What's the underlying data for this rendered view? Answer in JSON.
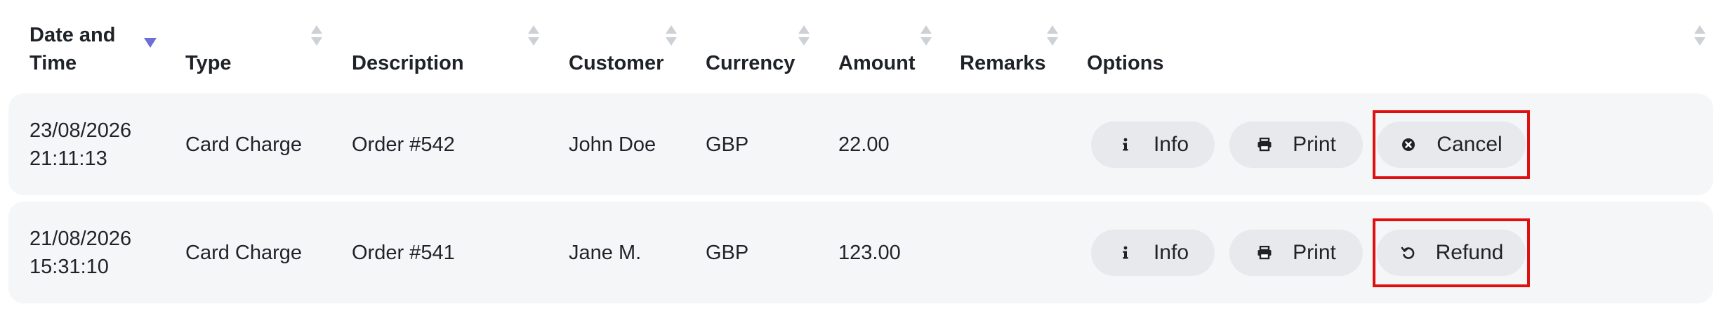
{
  "columns": {
    "datetime": "Date and\nTime",
    "type": "Type",
    "description": "Description",
    "customer": "Customer",
    "currency": "Currency",
    "amount": "Amount",
    "remarks": "Remarks",
    "options": "Options"
  },
  "rows": [
    {
      "datetime": "23/08/2026\n21:11:13",
      "type": "Card Charge",
      "description": "Order #542",
      "customer": "John Doe",
      "currency": "GBP",
      "amount": "22.00",
      "remarks": "",
      "actions": {
        "info": "Info",
        "print": "Print",
        "extra": "Cancel"
      }
    },
    {
      "datetime": "21/08/2026\n15:31:10",
      "type": "Card Charge",
      "description": "Order #541",
      "customer": "Jane M.",
      "currency": "GBP",
      "amount": "123.00",
      "remarks": "",
      "actions": {
        "info": "Info",
        "print": "Print",
        "extra": "Refund"
      }
    }
  ],
  "icons": {
    "info": "info-icon",
    "print": "printer-icon",
    "cancel": "x-circle-icon",
    "refund": "undo-icon"
  },
  "colors": {
    "highlight": "#e01010",
    "sort_active": "#6b6fd6",
    "row_bg": "#f5f6f8",
    "button_bg": "#e7e9ed"
  }
}
